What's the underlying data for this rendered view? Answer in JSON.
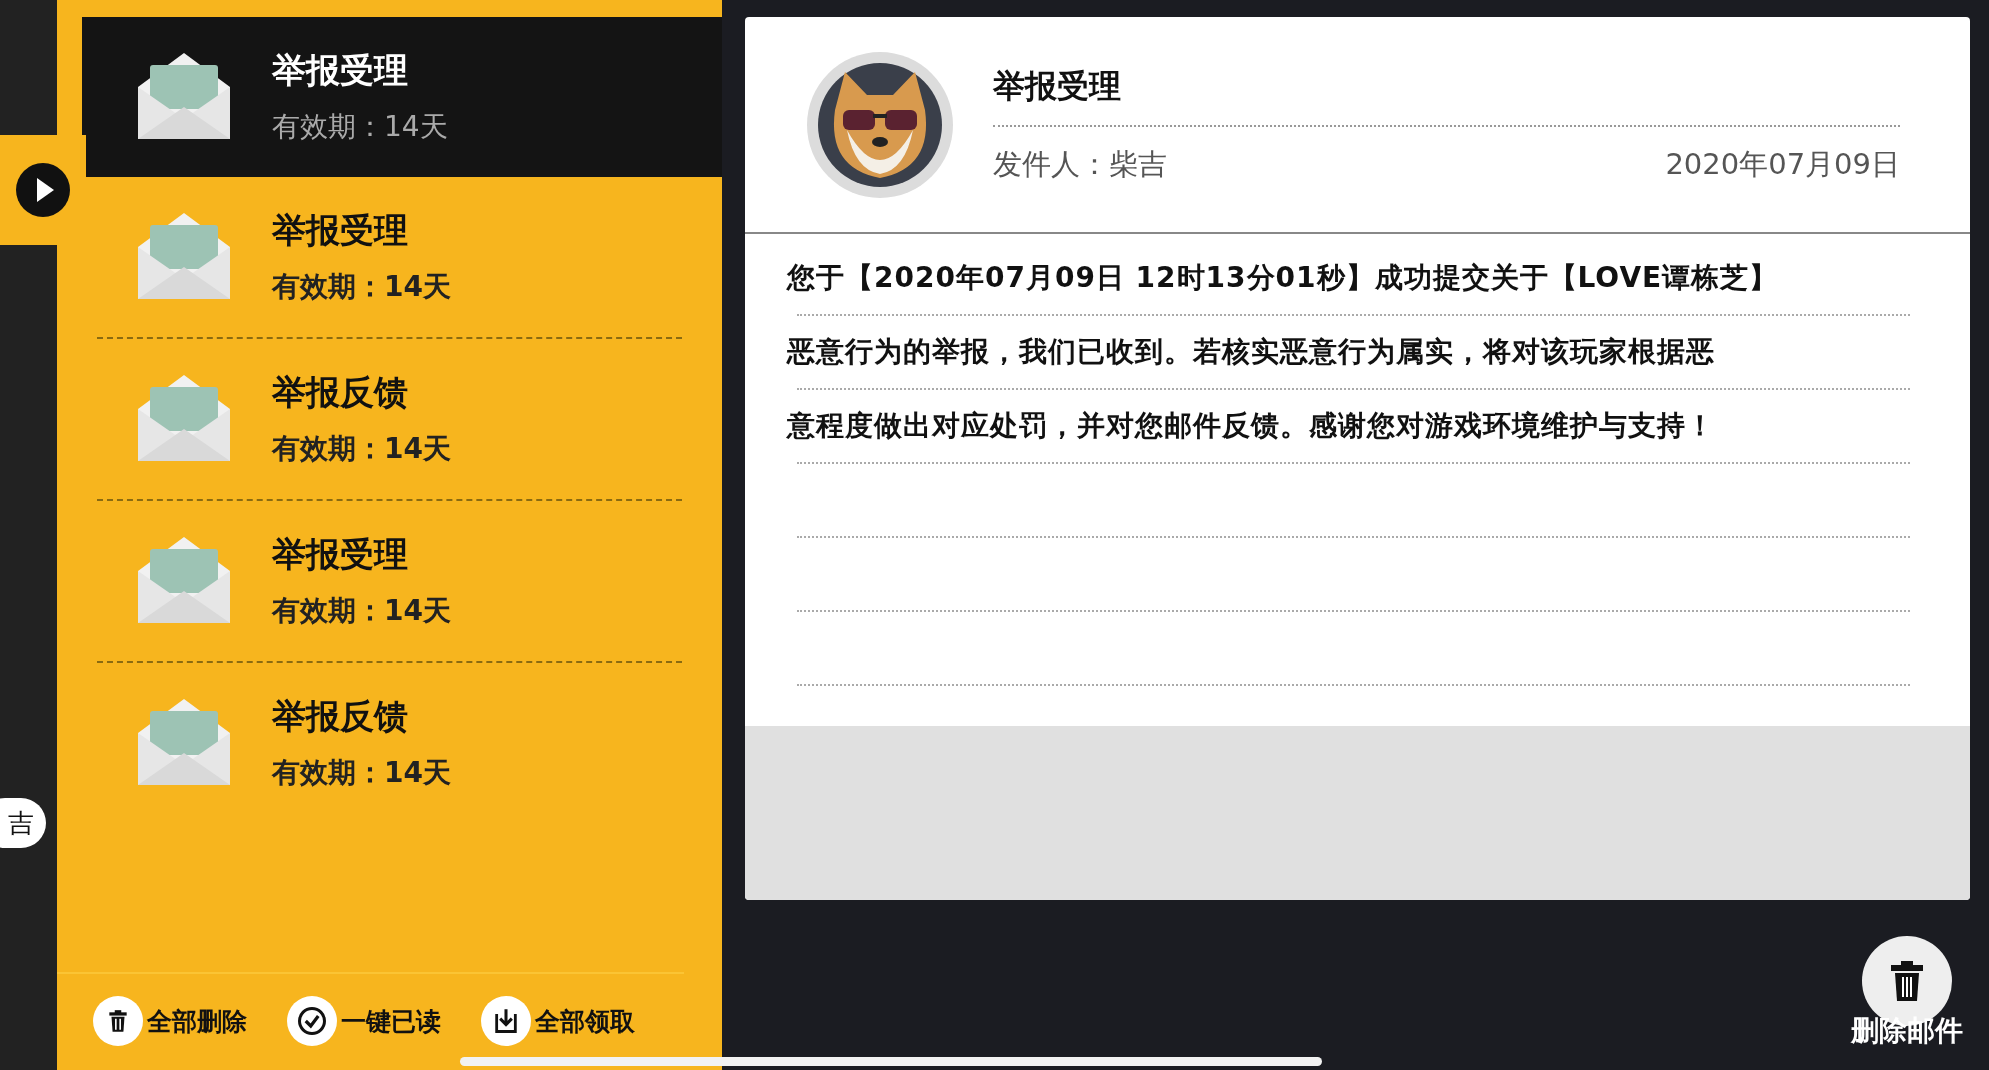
{
  "side_tab": {
    "label": "吉"
  },
  "mails": [
    {
      "title": "举报受理",
      "validity": "有效期：14天",
      "selected": true
    },
    {
      "title": "举报受理",
      "validity": "有效期：14天",
      "selected": false
    },
    {
      "title": "举报反馈",
      "validity": "有效期：14天",
      "selected": false
    },
    {
      "title": "举报受理",
      "validity": "有效期：14天",
      "selected": false
    },
    {
      "title": "举报反馈",
      "validity": "有效期：14天",
      "selected": false
    }
  ],
  "actions": [
    {
      "kind": "delete",
      "label": "全部删除"
    },
    {
      "kind": "read",
      "label": "一键已读"
    },
    {
      "kind": "claim",
      "label": "全部领取"
    }
  ],
  "detail": {
    "title": "举报受理",
    "sender": "发件人：柴吉",
    "date": "2020年07月09日",
    "body_lines": [
      "您于【2020年07月09日 12时13分01秒】成功提交关于【LOVE谭栋芝】",
      "恶意行为的举报，我们已收到。若核实恶意行为属实，将对该玩家根据恶",
      "意程度做出对应处罚，并对您邮件反馈。感谢您对游戏环境维护与支持！"
    ]
  },
  "delete_button": {
    "label": "删除邮件"
  }
}
